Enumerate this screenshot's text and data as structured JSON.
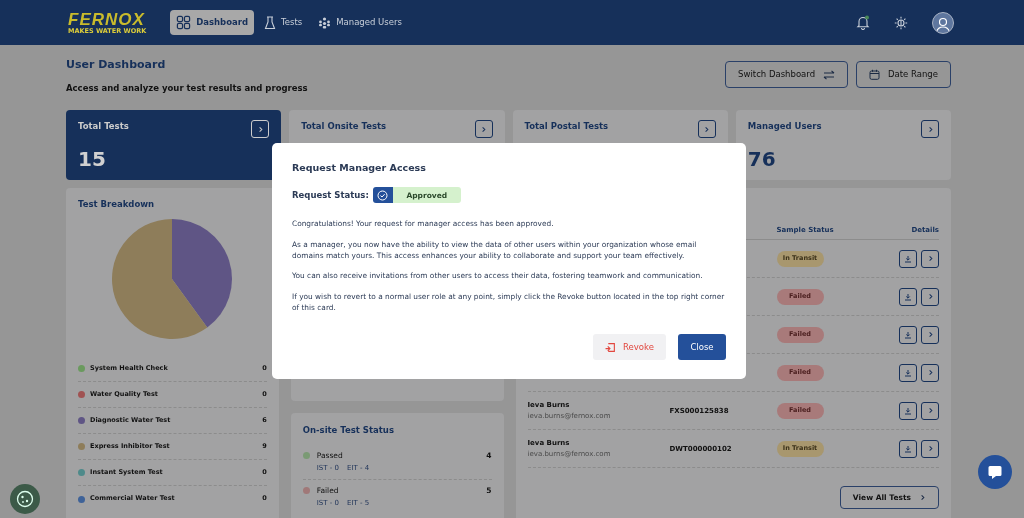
{
  "navbar": {
    "brand": "FERNOX",
    "tagline": "MAKES WATER WORK",
    "nav_items": [
      {
        "label": "Dashboard",
        "selected": true
      },
      {
        "label": "Tests",
        "selected": false
      },
      {
        "label": "Managed Users",
        "selected": false
      }
    ],
    "notifications": {
      "has_unread": true
    }
  },
  "header": {
    "title": "User Dashboard",
    "subtitle": "Access and analyze your test results and progress",
    "buttons": [
      {
        "label": "Switch Dashboard"
      },
      {
        "label": "Date Range"
      }
    ]
  },
  "stat_cards": [
    {
      "title": "Total Tests",
      "value": "15",
      "selected": true
    },
    {
      "title": "Total Onsite Tests",
      "selected": false
    },
    {
      "title": "Total Postal Tests",
      "selected": false
    },
    {
      "title": "Managed Users",
      "value": "76",
      "selected": false
    }
  ],
  "test_breakdown": {
    "title": "Test Breakdown",
    "chart_data": {
      "type": "pie",
      "categories": [
        "System Health Check",
        "Water Quality Test",
        "Diagnostic Water Test",
        "Express Inhibitor Test",
        "Instant System Test",
        "Commercial Water Test"
      ],
      "values": [
        0,
        0,
        40,
        60,
        0,
        0
      ]
    },
    "legend": [
      {
        "count": "0",
        "color": "#6a9a5e"
      },
      {
        "count": "0",
        "color": "#a05252"
      },
      {
        "count": "6",
        "color": "#5f5585"
      },
      {
        "count": "9",
        "color": "#8e7d5a"
      },
      {
        "count": "0",
        "color": "#4e8a8a"
      },
      {
        "count": "0",
        "color": "#3e6298"
      }
    ]
  },
  "onsite_status": {
    "title": "On-site Test Status",
    "items": [
      {
        "label": "Passed",
        "count": "4",
        "ist": "IST - 0",
        "eit": "EIT - 4",
        "color": "#7a9a74"
      },
      {
        "label": "Failed",
        "count": "5",
        "ist": "IST - 0",
        "eit": "EIT - 5",
        "color": "#a07878"
      }
    ]
  },
  "tests_table": {
    "columns": [
      "Sample Status",
      "Details"
    ],
    "rows": [
      {
        "status": "In Transit",
        "kind": "transit"
      },
      {
        "status": "Failed",
        "kind": "failed"
      },
      {
        "status": "Failed",
        "kind": "failed"
      },
      {
        "status": "Failed",
        "kind": "failed"
      },
      {
        "name": "Ieva Burns",
        "email": "ieva.burns@fernox.com",
        "test_id": "FXS000125838",
        "status": "Failed",
        "kind": "failed"
      },
      {
        "name": "Ieva Burns",
        "email": "ieva.burns@fernox.com",
        "test_id": "DWT000000102",
        "status": "In Transit",
        "kind": "transit"
      }
    ],
    "view_all": "View All Tests"
  },
  "modal": {
    "title": "Request Manager Access",
    "status_label": "Request Status:",
    "status": "Approved",
    "approved": true,
    "paragraphs": [
      "Congratulations! Your request for manager access has been approved.",
      "As a manager, you now have the ability to view the data of other users within your organization whose email domains match yours. This access enhances your ability to collaborate and support your team effectively.",
      "You can also receive invitations from other users to access their data, fostering teamwork and communication.",
      "If you wish to revert to a normal user role at any point, simply click the Revoke button located in the top right corner of this card."
    ],
    "buttons": [
      {
        "label": "Revoke",
        "kind": "revoke"
      },
      {
        "label": "Close",
        "kind": "close"
      }
    ]
  }
}
